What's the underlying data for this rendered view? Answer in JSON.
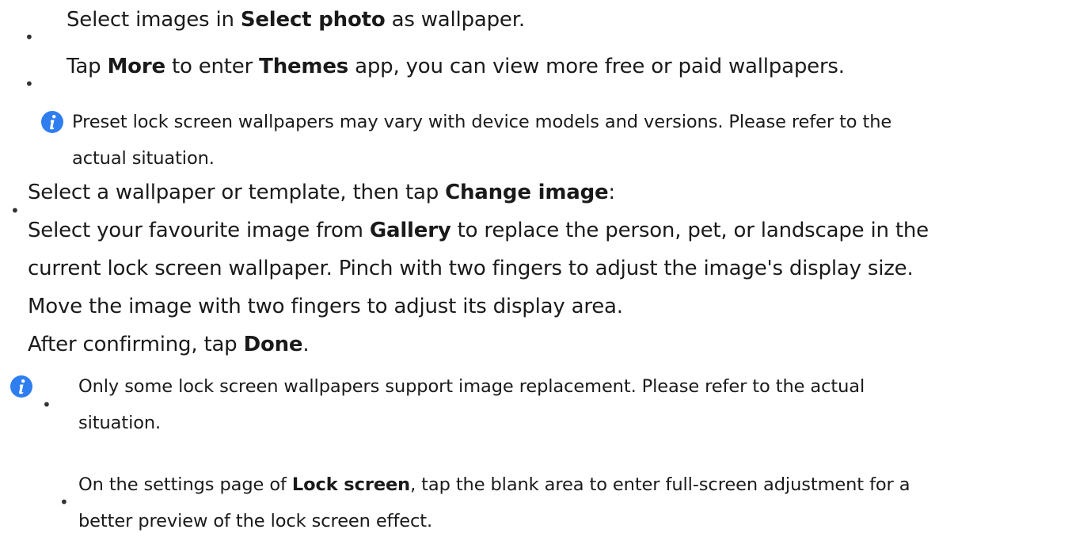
{
  "list1": {
    "item1": {
      "pre": "Select images in ",
      "bold1": "Select photo",
      "post": " as wallpaper."
    },
    "item2": {
      "pre": "Tap ",
      "bold1": "More",
      "mid": " to enter ",
      "bold2": "Themes",
      "post": " app, you can view more free or paid wallpapers."
    }
  },
  "note1": {
    "icon": "info-icon",
    "line1": "Preset lock screen wallpapers may vary with device models and versions. Please refer to the",
    "line2": "actual situation."
  },
  "section": {
    "line1": {
      "pre": "Select a wallpaper or template, then tap ",
      "bold1": "Change image",
      "post": ":"
    },
    "line2": {
      "pre": "Select your favourite image from ",
      "bold1": "Gallery",
      "post": " to replace the person, pet, or landscape in the"
    },
    "line3": "current lock screen wallpaper. Pinch with two fingers to adjust the image's display size.",
    "line4": "Move the image with two fingers to adjust its display area.",
    "line5": {
      "pre": "After confirming, tap ",
      "bold1": "Done",
      "post": "."
    }
  },
  "note2": {
    "icon": "info-icon",
    "item1": {
      "line1": "Only some lock screen wallpapers support image replacement. Please refer to the actual",
      "line2": "situation."
    },
    "item2": {
      "pre": "On the settings page of ",
      "bold1": "Lock screen",
      "post": ", tap the blank area to enter full-screen adjustment for a",
      "line2": "better preview of the lock screen effect."
    }
  },
  "colors": {
    "accent": "#2e7ef0",
    "text": "#1a1a1a"
  },
  "bullet_char": "•"
}
